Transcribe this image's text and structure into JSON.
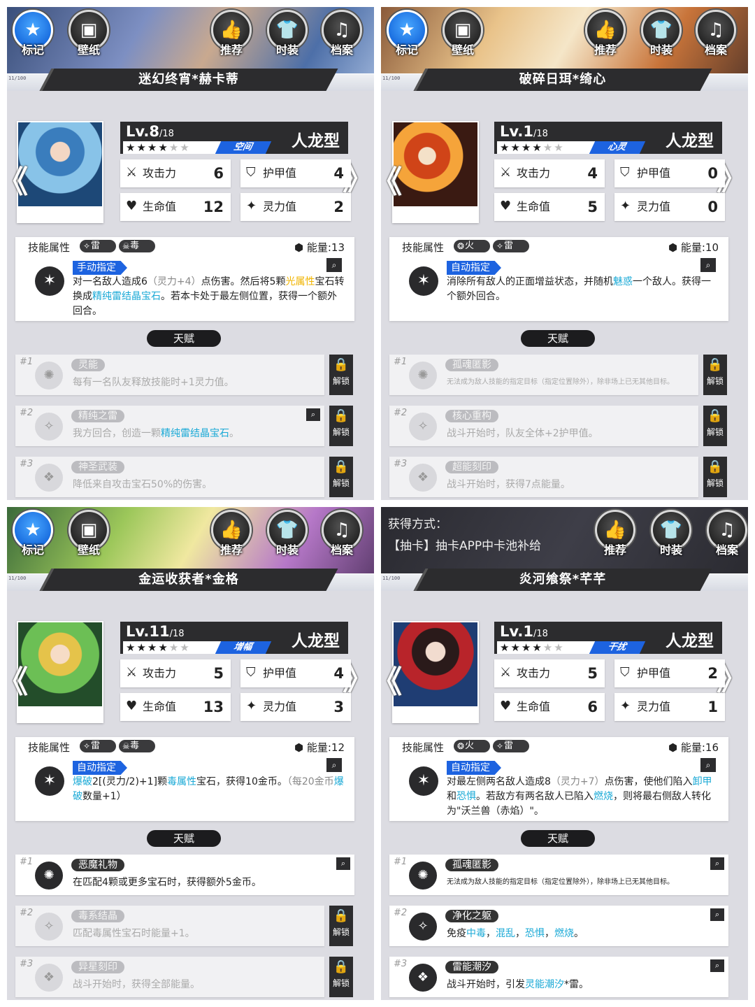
{
  "panels": [
    {
      "show_mark": true,
      "show_wallpaper": true,
      "acquire": null,
      "buttons": [
        "标记",
        "壁纸",
        "推荐",
        "时装",
        "档案"
      ],
      "name": "迷幻终宵*赫卡蒂",
      "strip_mark": "11/100",
      "level": "Lv.8",
      "level_max": "/18",
      "stars_filled": 4,
      "stars_total": 6,
      "element": "空间",
      "race": "人龙型",
      "stats": {
        "atk_label": "攻击力",
        "atk": "6",
        "armor_label": "护甲值",
        "armor": "4",
        "hp_label": "生命值",
        "hp": "12",
        "spirit_label": "灵力值",
        "spirit": "2"
      },
      "skill": {
        "label": "技能属性",
        "tags": [
          "雷",
          "毒"
        ],
        "energy": "能量:13",
        "mode": "手动指定",
        "desc": [
          "对一名敌人造成6",
          "（灵力+4）",
          "点伤害。然后将5颗",
          "光属性",
          "宝石转换成",
          "精纯雷结晶宝石",
          "。若本卡处于最左侧位置，获得一个额外回合。"
        ]
      },
      "talent_label": "天赋",
      "talents": [
        {
          "num": "#1",
          "name": "灵能",
          "desc": "每有一名队友释放技能时+1灵力值。",
          "locked": true,
          "unlock": "解锁"
        },
        {
          "num": "#2",
          "name": "精纯之雷",
          "desc_a": "我方回合，创造一颗",
          "desc_hl": "精纯雷结晶宝石",
          "desc_b": "。",
          "locked": true,
          "unlock": "解锁"
        },
        {
          "num": "#3",
          "name": "神圣武装",
          "desc": "降低来自攻击宝石50%的伤害。",
          "locked": true,
          "unlock": "解锁"
        }
      ]
    },
    {
      "show_mark": true,
      "show_wallpaper": true,
      "acquire": null,
      "buttons": [
        "标记",
        "壁纸",
        "推荐",
        "时装",
        "档案"
      ],
      "name": "破碎日珥*绮心",
      "strip_mark": "11/100",
      "level": "Lv.1",
      "level_max": "/18",
      "stars_filled": 4,
      "stars_total": 6,
      "element": "心灵",
      "race": "人龙型",
      "stats": {
        "atk_label": "攻击力",
        "atk": "4",
        "armor_label": "护甲值",
        "armor": "0",
        "hp_label": "生命值",
        "hp": "5",
        "spirit_label": "灵力值",
        "spirit": "0"
      },
      "skill": {
        "label": "技能属性",
        "tags": [
          "火",
          "雷"
        ],
        "energy": "能量:10",
        "mode": "自动指定",
        "desc": [
          "消除所有敌人的正面增益状态，并随机",
          "魅惑",
          "一个敌人。获得一个额外回合。"
        ]
      },
      "talent_label": "天赋",
      "talents": [
        {
          "num": "#1",
          "name": "孤魂匿影",
          "desc": "无法成为敌人技能的指定目标（指定位置除外），除非场上已无其他目标。",
          "locked": true,
          "unlock": "解锁"
        },
        {
          "num": "#2",
          "name": "核心重构",
          "desc": "战斗开始时，队友全体+2护甲值。",
          "locked": true,
          "unlock": "解锁"
        },
        {
          "num": "#3",
          "name": "超能刻印",
          "desc": "战斗开始时，获得7点能量。",
          "locked": true,
          "unlock": "解锁"
        }
      ]
    },
    {
      "show_mark": true,
      "show_wallpaper": true,
      "acquire": null,
      "buttons": [
        "标记",
        "壁纸",
        "推荐",
        "时装",
        "档案"
      ],
      "name": "金运收获者*金格",
      "strip_mark": "11/100",
      "level": "Lv.11",
      "level_max": "/18",
      "stars_filled": 4,
      "stars_total": 6,
      "element": "增幅",
      "race": "人龙型",
      "stats": {
        "atk_label": "攻击力",
        "atk": "5",
        "armor_label": "护甲值",
        "armor": "4",
        "hp_label": "生命值",
        "hp": "13",
        "spirit_label": "灵力值",
        "spirit": "3"
      },
      "skill": {
        "label": "技能属性",
        "tags": [
          "雷",
          "毒"
        ],
        "energy": "能量:12",
        "mode": "自动指定",
        "desc": [
          "爆破",
          "2[(灵力/2)+1]颗",
          "毒属性",
          "宝石，获得10金币。",
          "（每20金币",
          "爆破",
          "数量+1）"
        ]
      },
      "talent_label": "天赋",
      "talents": [
        {
          "num": "#1",
          "name": "恶魔礼物",
          "desc": "在匹配4颗或更多宝石时，获得额外5金币。",
          "locked": false,
          "unlock": ""
        },
        {
          "num": "#2",
          "name": "毒系结晶",
          "desc": "匹配毒属性宝石时能量+1。",
          "locked": true,
          "unlock": "解锁"
        },
        {
          "num": "#3",
          "name": "异星刻印",
          "desc": "战斗开始时，获得全部能量。",
          "locked": true,
          "unlock": "解锁"
        }
      ]
    },
    {
      "show_mark": false,
      "show_wallpaper": false,
      "acquire": {
        "title": "获得方式：",
        "text": "【抽卡】抽卡APP中卡池补给"
      },
      "buttons": [
        "推荐",
        "时装",
        "档案"
      ],
      "name": "炎河飨祭*芊芊",
      "strip_mark": "11/100",
      "level": "Lv.1",
      "level_max": "/18",
      "stars_filled": 4,
      "stars_total": 6,
      "element": "干扰",
      "race": "人龙型",
      "stats": {
        "atk_label": "攻击力",
        "atk": "5",
        "armor_label": "护甲值",
        "armor": "2",
        "hp_label": "生命值",
        "hp": "6",
        "spirit_label": "灵力值",
        "spirit": "1"
      },
      "skill": {
        "label": "技能属性",
        "tags": [
          "火",
          "雷"
        ],
        "energy": "能量:16",
        "mode": "自动指定",
        "desc": [
          "对最左侧两名敌人造成8",
          "（灵力+7）",
          "点伤害，使他们陷入",
          "卸甲",
          "和",
          "恐惧",
          "。若敌方有两名敌人已陷入",
          "燃烧",
          "，则将最右侧敌人转化为\"沃兰兽（赤焰）\"。"
        ]
      },
      "talent_label": "天赋",
      "talents": [
        {
          "num": "#1",
          "name": "孤魂匿影",
          "desc": "无法成为敌人技能的指定目标（指定位置除外），除非场上已无其他目标。",
          "locked": false,
          "unlock": ""
        },
        {
          "num": "#2",
          "name": "净化之躯",
          "desc_a": "免疫",
          "desc_list": [
            "中毒",
            "混乱",
            "恐惧",
            "燃烧"
          ],
          "desc_b": "。",
          "locked": false,
          "unlock": ""
        },
        {
          "num": "#3",
          "name": "雷能潮汐",
          "desc_a": "战斗开始时，引发",
          "desc_hl": "灵能潮汐",
          "desc_b": "*雷。",
          "locked": false,
          "unlock": ""
        }
      ]
    }
  ],
  "icons": {
    "mark": "star-icon",
    "wallpaper": "image-icon",
    "recommend": "thumbs-up-icon",
    "fashion": "shirt-icon",
    "archive": "music-file-icon",
    "attack": "sword-icon",
    "armor": "shield-icon",
    "hp": "heart-icon",
    "spirit": "sparkle-icon",
    "energy": "energy-icon",
    "lock": "lock-icon",
    "magnifier": "magnifier-icon"
  },
  "colors": {
    "accent": "#1d63e0",
    "highlight": "#19a9d6",
    "gold": "#f0b400",
    "dark": "#2c2c2e"
  }
}
